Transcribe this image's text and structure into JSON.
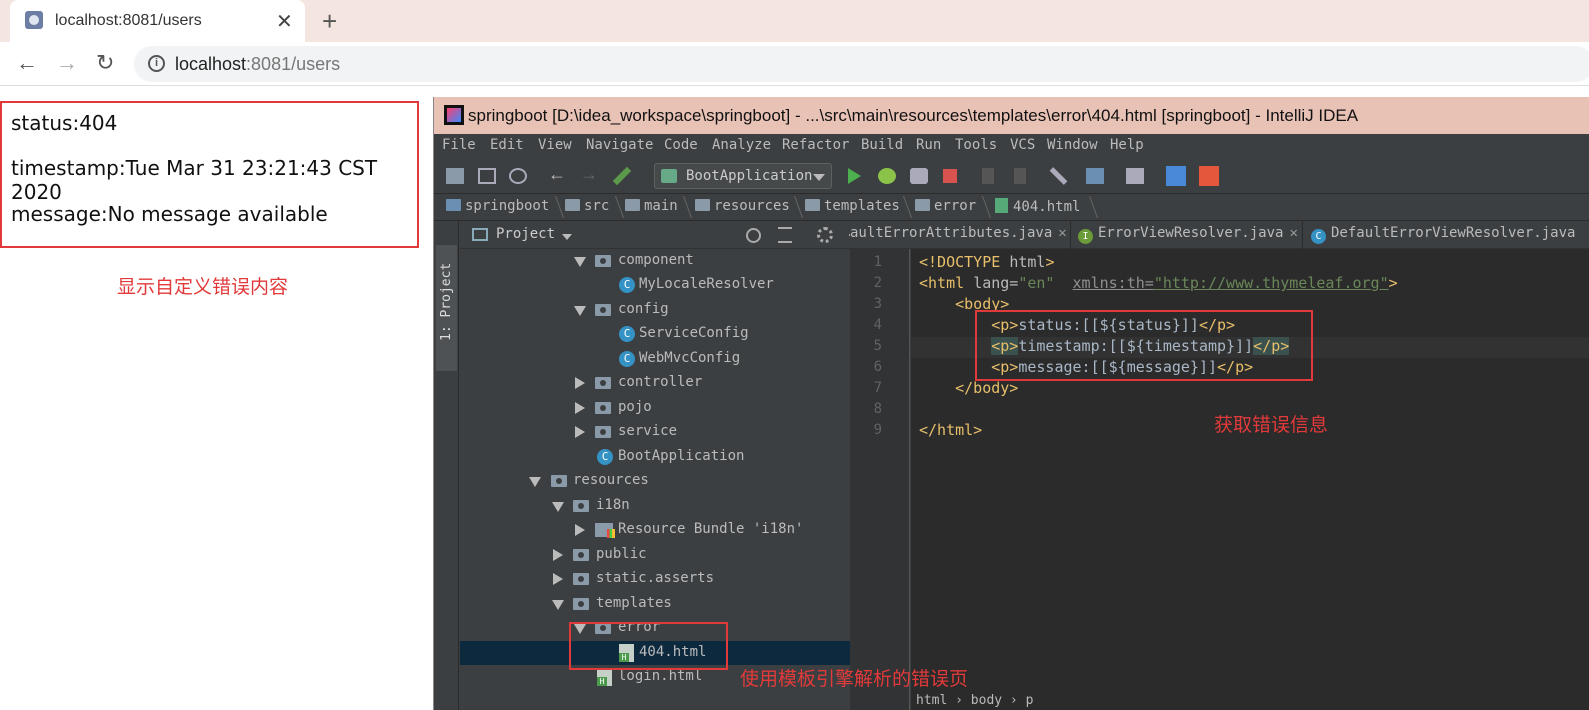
{
  "browser": {
    "tab_title": "localhost:8081/users",
    "tab_close": "✕",
    "new_tab": "+",
    "url_host": "localhost",
    "url_rest": ":8081/users",
    "back": "←",
    "forward": "→",
    "reload": "↻"
  },
  "page": {
    "status": "status:404",
    "timestamp": "timestamp:Tue Mar 31 23:21:43 CST 2020",
    "message": "message:No message available"
  },
  "annotations": {
    "custom_error": "显示自定义错误内容",
    "get_error_info": "获取错误信息",
    "template_error_page": "使用模板引擎解析的错误页"
  },
  "ide": {
    "title": "springboot [D:\\idea_workspace\\springboot] - ...\\src\\main\\resources\\templates\\error\\404.html [springboot] - IntelliJ IDEA",
    "menu": [
      "File",
      "Edit",
      "View",
      "Navigate",
      "Code",
      "Analyze",
      "Refactor",
      "Build",
      "Run",
      "Tools",
      "VCS",
      "Window",
      "Help"
    ],
    "run_config": "BootApplication",
    "breadcrumbs": [
      "springboot",
      "src",
      "main",
      "resources",
      "templates",
      "error",
      "404.html"
    ],
    "side_tab": "1: Project",
    "project_panel_title": "Project",
    "tree": [
      {
        "label": "component",
        "icon": "folder",
        "toggle": "open"
      },
      {
        "label": "MyLocaleResolver",
        "icon": "class"
      },
      {
        "label": "config",
        "icon": "folder",
        "toggle": "open"
      },
      {
        "label": "ServiceConfig",
        "icon": "class"
      },
      {
        "label": "WebMvcConfig",
        "icon": "class"
      },
      {
        "label": "controller",
        "icon": "folder",
        "toggle": "closed"
      },
      {
        "label": "pojo",
        "icon": "folder",
        "toggle": "closed"
      },
      {
        "label": "service",
        "icon": "folder",
        "toggle": "closed"
      },
      {
        "label": "BootApplication",
        "icon": "spring-boot-class"
      },
      {
        "label": "resources",
        "icon": "folder",
        "toggle": "open"
      },
      {
        "label": "i18n",
        "icon": "folder",
        "toggle": "open"
      },
      {
        "label": "Resource Bundle 'i18n'",
        "icon": "bundle",
        "toggle": "closed"
      },
      {
        "label": "public",
        "icon": "folder",
        "toggle": "closed"
      },
      {
        "label": "static.asserts",
        "icon": "folder",
        "toggle": "closed"
      },
      {
        "label": "templates",
        "icon": "folder",
        "toggle": "open"
      },
      {
        "label": "error",
        "icon": "folder",
        "toggle": "open"
      },
      {
        "label": "404.html",
        "icon": "html",
        "selected": true
      },
      {
        "label": "login.html",
        "icon": "html"
      }
    ],
    "editor_tabs": [
      {
        "label": "aultErrorAttributes.java",
        "icon": "class"
      },
      {
        "label": "ErrorViewResolver.java",
        "icon": "interface"
      },
      {
        "label": "DefaultErrorViewResolver.java",
        "icon": "class"
      }
    ],
    "line_numbers": [
      "1",
      "2",
      "3",
      "4",
      "5",
      "6",
      "7",
      "8",
      "9"
    ],
    "footer_breadcrumb": "html  ›  body  ›  p"
  },
  "colors": {
    "annotation_red": "#e23a3a",
    "ide_bg": "#2b2b2b",
    "tag": "#e8bf6a",
    "string": "#6a8759"
  }
}
